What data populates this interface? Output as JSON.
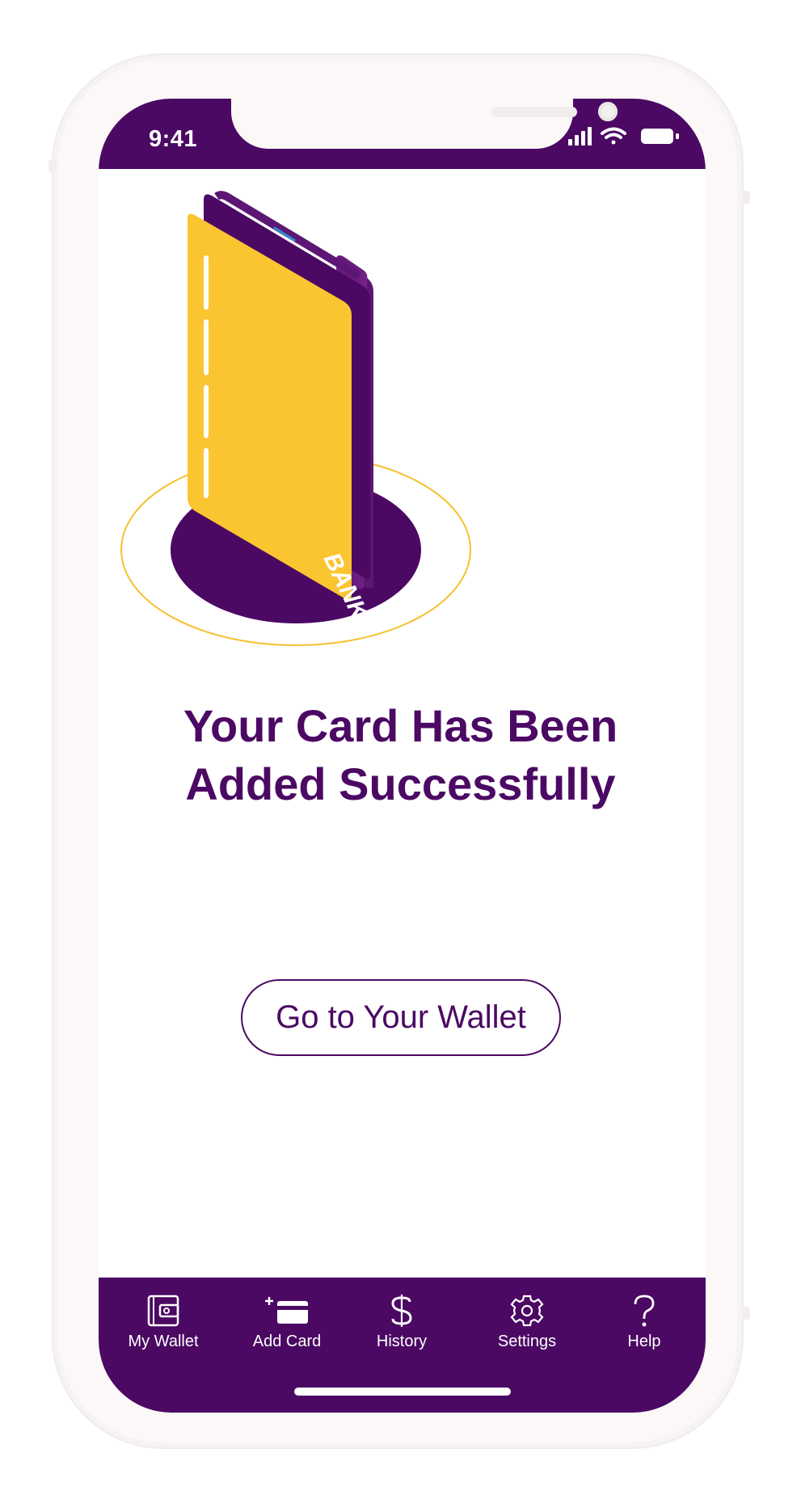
{
  "status_bar": {
    "time": "9:41",
    "icons": [
      "signal-icon",
      "wifi-icon",
      "battery-icon"
    ]
  },
  "illustration": {
    "card_brand_text": "BANK"
  },
  "main": {
    "headline_line1": "Your Card Has Been",
    "headline_line2": "Added Successfully",
    "wallet_button_label": "Go to Your Wallet"
  },
  "tabbar": {
    "items": [
      {
        "label": "My Wallet",
        "icon": "wallet-icon"
      },
      {
        "label": "Add Card",
        "icon": "add-card-icon"
      },
      {
        "label": "History",
        "icon": "dollar-icon"
      },
      {
        "label": "Settings",
        "icon": "gear-icon"
      },
      {
        "label": "Help",
        "icon": "question-icon"
      }
    ]
  },
  "colors": {
    "brand_purple": "#4b0963",
    "card_yellow": "#fbc531",
    "ring_yellow": "#f4c12e",
    "background": "#ffffff"
  }
}
